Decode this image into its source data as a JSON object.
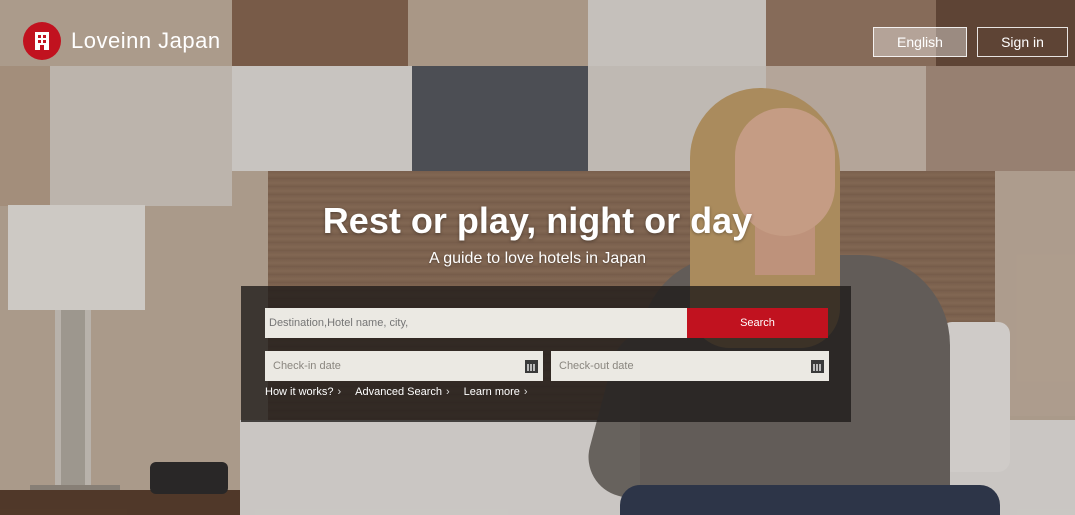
{
  "header": {
    "brand": "Loveinn Japan",
    "language_label": "English",
    "signin_label": "Sign in"
  },
  "hero": {
    "headline": "Rest or play, night or day",
    "tagline": "A guide to love hotels in Japan"
  },
  "search": {
    "placeholder": "Destination,Hotel name, city,",
    "button_label": "Search",
    "checkin_placeholder": "Check-in date",
    "checkout_placeholder": "Check-out date"
  },
  "links": [
    {
      "label": "How it works?"
    },
    {
      "label": "Advanced Search"
    },
    {
      "label": "Learn more"
    }
  ],
  "colors": {
    "brand_red": "#c1121f",
    "panel_bg": "#1e1a18",
    "field_bg": "#ebe9e3"
  },
  "icons": {
    "logo": "building-icon",
    "calendar": "calendar-icon",
    "link_arrow": "chevron-right-icon"
  }
}
